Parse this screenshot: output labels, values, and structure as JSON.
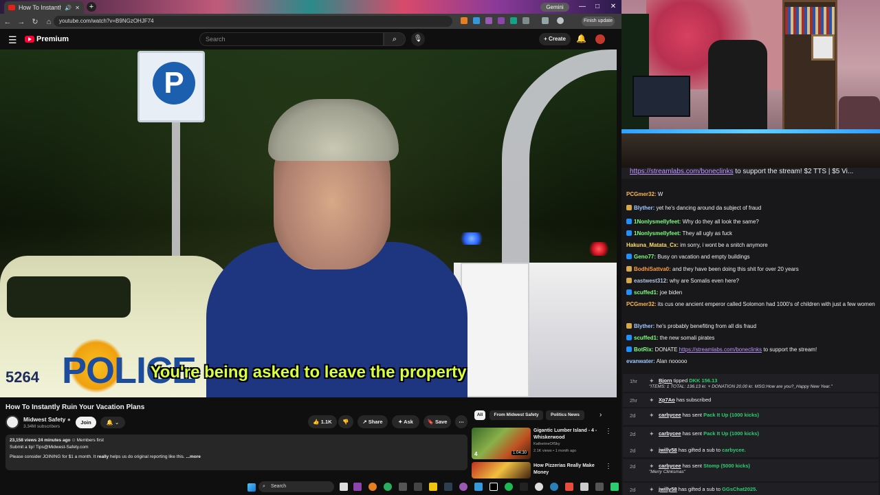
{
  "browser": {
    "tab_title": "How To Instantly Ruin Your",
    "new_tab": "+",
    "gemini_label": "Gemini",
    "url": "youtube.com/watch?v=B9NGzOHJF74",
    "finish_update": "Finish update",
    "win_min": "—",
    "win_max": "□",
    "win_close": "✕"
  },
  "youtube": {
    "logo_text": "Premium",
    "search_placeholder": "Search",
    "create_label": "Create",
    "subtitle": "You're being asked to leave the property",
    "police_text": "POLICE",
    "car_number": "5264",
    "video_title": "How To Instantly Ruin Your Vacation Plans",
    "channel_name": "Midwest Safety",
    "channel_subs": "3.34M subscribers",
    "join_label": "Join",
    "likes": "1.1K",
    "share_label": "Share",
    "ask_label": "Ask",
    "save_label": "Save",
    "desc_stats": "23,158 views  24 minutes ago",
    "desc_members": "Members first",
    "desc_line1": "Submit a tip! Tips@Midwest-Safety.com",
    "desc_line2a": "Please consider JOINING for $1 a month. It ",
    "desc_line2b": "really",
    "desc_line2c": " helps us do original reporting like this.",
    "desc_more": "...more",
    "chips": [
      "All",
      "From Midwest Safety",
      "Politics News"
    ],
    "recs": [
      {
        "title": "Gigantic Lumber Island - 4 - Whiskerwood",
        "channel": "KatherineOfSky",
        "meta": "2.1K views • 1 month ago",
        "duration": "1:04:30",
        "badge": "4"
      },
      {
        "title": "How Pizzerias Really Make Money",
        "channel": "",
        "meta": "",
        "duration": "",
        "badge": ""
      }
    ]
  },
  "chat": {
    "pinned_link": "https://streamlabs.com/boneclinks",
    "pinned_rest": " to support the stream! $2 TTS | $5 Vi...",
    "messages": [
      {
        "user": "PCGmer32:",
        "color": "#ffb84d",
        "text": " W"
      },
      {
        "user": "Blyther:",
        "color": "#9ecbff",
        "text": " yet he's dancing around da subject of fraud"
      },
      {
        "user": "1Nonlysmellyfeet:",
        "color": "#7fff7f",
        "text": " Why do they all look the same?"
      },
      {
        "user": "1Nonlysmellyfeet:",
        "color": "#7fff7f",
        "text": " They all ugly as fuck"
      },
      {
        "user": "Hakuna_Matata_Cx:",
        "color": "#ffe066",
        "text": " im sorry, i wont be a snitch anymore"
      },
      {
        "user": "Geno77:",
        "color": "#7fff7f",
        "text": " Busy on vacation and empty buildings"
      },
      {
        "user": "BodhiSattva0:",
        "color": "#ff9f40",
        "text": " and they have been doing this shit for over 20 years"
      },
      {
        "user": "eastwest312:",
        "color": "#b0c4de",
        "text": " why are Somalis even here?"
      },
      {
        "user": "scuffed1:",
        "color": "#7fff7f",
        "text": " joe biden"
      },
      {
        "user": "PCGmer32:",
        "color": "#ffb84d",
        "text": " its cus one ancient emperor called Solomon had 1000's of children with just a few women"
      },
      {
        "user": "Blyther:",
        "color": "#9ecbff",
        "text": " he's probably benefiting from all dis fraud"
      },
      {
        "user": "scuffed1:",
        "color": "#7fff7f",
        "text": " the new somali pirates"
      },
      {
        "user": "BotRix:",
        "color": "#7fff7f",
        "text": " DONATE "
      },
      {
        "user": "evanwater:",
        "color": "#9ecbff",
        "text": " Alan nooooo"
      }
    ],
    "botrix_link": "https://streamlabs.com/boneclinks",
    "botrix_rest": " to support the stream!"
  },
  "events": [
    {
      "time": "1hr",
      "name": "Bjorn",
      "mid": " tipped ",
      "gift": "DKK 156.13",
      "sub": "\"ITEMS: 1 TOTAL: 136.13 kr. + DONATION 20.00 kr. MSG:How are you?_Happy New Year.\""
    },
    {
      "time": "2hr",
      "name": "Xp7Ao",
      "mid": " has subscribed",
      "gift": "",
      "sub": ""
    },
    {
      "time": "2d",
      "name": "carbycee",
      "mid": " has sent ",
      "gift": "Pack It Up (1000 kicks)",
      "sub": ""
    },
    {
      "time": "2d",
      "name": "carbycee",
      "mid": " has sent ",
      "gift": "Pack It Up (1000 kicks)",
      "sub": ""
    },
    {
      "time": "2d",
      "name": "jwilly58",
      "mid": " has gifted a sub to ",
      "gift": "carbycee.",
      "sub": ""
    },
    {
      "time": "2d",
      "name": "carbycee",
      "mid": " has sent ",
      "gift": "Stomp (5000 kicks)",
      "sub": "\"Merry Clinksmas\""
    },
    {
      "time": "2d",
      "name": "jwilly58",
      "mid": " has gifted a sub to ",
      "gift": "GGsChat2025.",
      "sub": ""
    }
  ],
  "taskbar": {
    "search_label": "Search"
  },
  "colors": {
    "yt_red": "#ff0033",
    "subtitle": "#d8ff40",
    "chat_bg": "#18181b",
    "kick_green": "#2ecc71"
  }
}
